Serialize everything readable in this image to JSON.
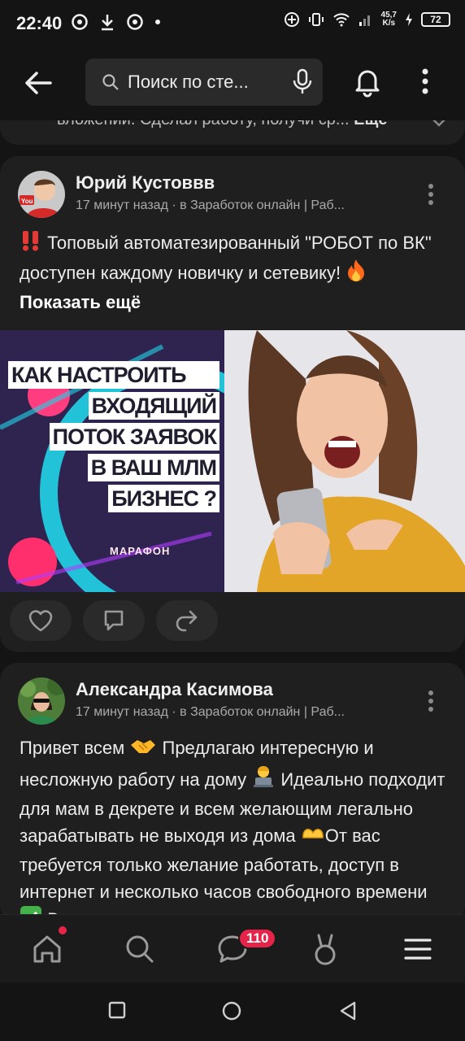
{
  "status_bar": {
    "time": "22:40",
    "net_speed_value": "45,7",
    "net_speed_unit": "K/s",
    "battery": "72",
    "icons": [
      "chrome-icon",
      "download-icon",
      "chrome-icon",
      "dot-icon",
      "data-saver-icon",
      "vibrate-icon",
      "wifi-icon",
      "signal-icon",
      "charging-icon"
    ]
  },
  "header": {
    "search_placeholder": "Поиск по сте...",
    "icons": [
      "back-arrow-icon",
      "search-icon",
      "microphone-icon",
      "bell-icon",
      "more-vertical-icon"
    ]
  },
  "prev_post": {
    "text": "вложении. Сделал работу, получи ср...",
    "more_label": "Ещё"
  },
  "posts": [
    {
      "author": "Юрий Кустоввв",
      "meta": "17 минут назад · в Заработок онлайн | Раб...",
      "text_before_emoji": "Топовый  автоматезированный \"РОБОТ по ВК\"  доступен каждому новичку и сетевику! ",
      "show_more": "Показать ещё",
      "image_left_lines": [
        "КАК НАСТРОИТЬ",
        "ВХОДЯЩИЙ",
        "ПОТОК ЗАЯВОК",
        "В ВАШ МЛМ",
        "БИЗНЕС ?"
      ],
      "image_left_brand": "МАРАФОН"
    },
    {
      "author": "Александра Касимова",
      "meta": "17 минут назад · в Заработок онлайн | Раб...",
      "text_parts": [
        "Привет всем ",
        " Предлагаю интересную и несложную работу на дому ",
        " Идеально подходит для мам в декрете и всем желающим легально зарабатывать не выходя из дома ",
        "От вас требуется только желание работать, доступ в интернет и несколько часов свободного времени ",
        " Всему"
      ]
    }
  ],
  "bottom_nav": {
    "items": [
      "home-icon",
      "search-icon",
      "messages-icon",
      "clips-icon",
      "menu-icon"
    ],
    "messages_badge": "110"
  },
  "system_nav": [
    "recents-icon",
    "home-circle-icon",
    "back-triangle-icon"
  ]
}
